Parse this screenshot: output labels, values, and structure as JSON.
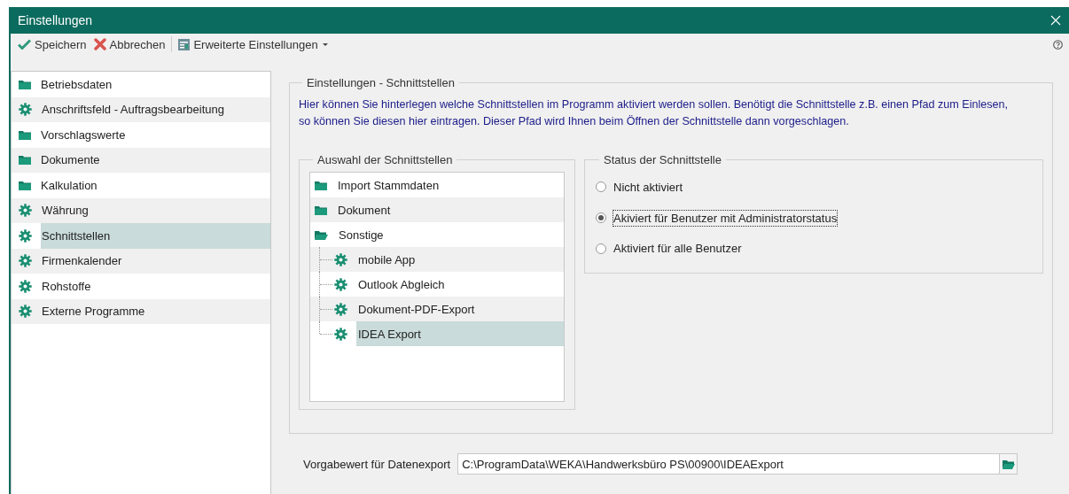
{
  "window": {
    "title": "Einstellungen"
  },
  "toolbar": {
    "groups": [
      [
        {
          "label": "Speichern",
          "kind": "save"
        },
        {
          "label": "Abbrechen",
          "kind": "cancel"
        }
      ],
      [
        {
          "label": "Erweiterte Einstellungen",
          "kind": "menu"
        }
      ]
    ]
  },
  "sidebar": {
    "items": [
      {
        "label": "Betriebsdaten",
        "kind": "folder",
        "selected": false
      },
      {
        "label": "Anschriftsfeld - Auftragsbearbeitung",
        "kind": "gear",
        "selected": false
      },
      {
        "label": "Vorschlagswerte",
        "kind": "folder",
        "selected": false
      },
      {
        "label": "Dokumente",
        "kind": "folder",
        "selected": false
      },
      {
        "label": "Kalkulation",
        "kind": "folder",
        "selected": false
      },
      {
        "label": "Währung",
        "kind": "gear",
        "selected": false
      },
      {
        "label": "Schnittstellen",
        "kind": "gear",
        "selected": true
      },
      {
        "label": "Firmenkalender",
        "kind": "gear",
        "selected": false
      },
      {
        "label": "Rohstoffe",
        "kind": "gear",
        "selected": false
      },
      {
        "label": "Externe Programme",
        "kind": "gear",
        "selected": false
      }
    ]
  },
  "settings": {
    "title": "Einstellungen - Schnittstellen",
    "description": "Hier können Sie hinterlegen welche Schnittstellen im Programm aktiviert werden sollen. Benötigt die Schnittstelle z.B. einen Pfad zum Einlesen, so können Sie diesen hier eintragen. Dieser Pfad wird Ihnen beim Öffnen der Schnittstelle dann vorgeschlagen.",
    "selection": {
      "title": "Auswahl der Schnittstellen",
      "tree": [
        {
          "label": "Import Stammdaten",
          "kind": "folder",
          "expanded": false,
          "selected": false
        },
        {
          "label": "Dokument",
          "kind": "folder",
          "expanded": false,
          "selected": false
        },
        {
          "label": "Sonstige",
          "kind": "folder",
          "expanded": true,
          "selected": false,
          "children": [
            {
              "label": "mobile App",
              "kind": "gear",
              "selected": false
            },
            {
              "label": "Outlook Abgleich",
              "kind": "gear",
              "selected": false
            },
            {
              "label": "Dokument-PDF-Export",
              "kind": "gear",
              "selected": false
            },
            {
              "label": "IDEA Export",
              "kind": "gear",
              "selected": true
            }
          ]
        }
      ]
    },
    "status": {
      "title": "Status der Schnittstelle",
      "options": [
        {
          "label": "Nicht aktiviert",
          "selected": false
        },
        {
          "label": "Akiviert für Benutzer mit Administratorstatus",
          "selected": true
        },
        {
          "label": "Aktiviert für alle Benutzer",
          "selected": false
        }
      ]
    }
  },
  "export": {
    "label": "Vorgabewert für Datenexport",
    "value": "C:\\ProgramData\\WEKA\\Handwerksbüro PS\\00900\\IDEAExport"
  }
}
